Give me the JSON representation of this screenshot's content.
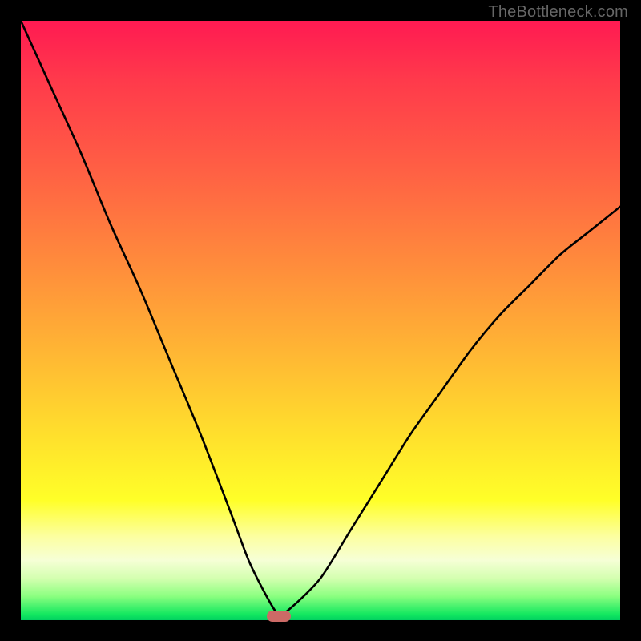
{
  "attribution": "TheBottleneck.com",
  "colors": {
    "frame": "#000000",
    "gradient_top": "#ff1a52",
    "gradient_mid": "#ffe22c",
    "gradient_bottom": "#00d060",
    "curve": "#000000",
    "marker": "#cc6a66",
    "attribution_text": "#666666"
  },
  "chart_data": {
    "type": "line",
    "title": "",
    "xlabel": "",
    "ylabel": "",
    "xlim": [
      0,
      1
    ],
    "ylim": [
      0,
      1
    ],
    "notes": "V-shaped bottleneck curve on a vertical red→yellow→green gradient. Minimum (optimal point) marked with a rounded pill near the bottom. Axes are unlabeled; values are normalized.",
    "series": [
      {
        "name": "bottleneck-curve",
        "x": [
          0.0,
          0.05,
          0.1,
          0.15,
          0.2,
          0.25,
          0.3,
          0.35,
          0.38,
          0.41,
          0.43,
          0.45,
          0.5,
          0.55,
          0.6,
          0.65,
          0.7,
          0.75,
          0.8,
          0.85,
          0.9,
          0.95,
          1.0
        ],
        "y": [
          1.0,
          0.89,
          0.78,
          0.66,
          0.55,
          0.43,
          0.31,
          0.18,
          0.1,
          0.04,
          0.01,
          0.02,
          0.07,
          0.15,
          0.23,
          0.31,
          0.38,
          0.45,
          0.51,
          0.56,
          0.61,
          0.65,
          0.69
        ]
      }
    ],
    "optimal_point": {
      "x": 0.43,
      "y": 0.0
    }
  }
}
